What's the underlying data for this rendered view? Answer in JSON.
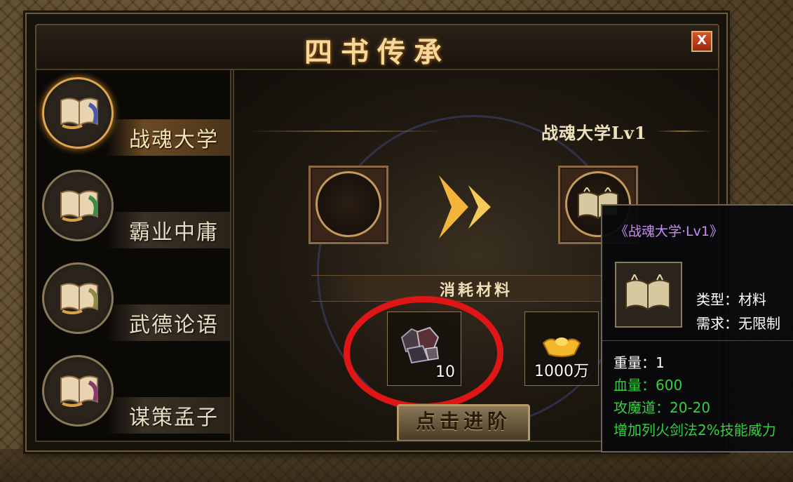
{
  "window": {
    "title": "四书传承",
    "close_label": "X"
  },
  "sidebar": {
    "items": [
      {
        "label": "战魂大学",
        "active": true,
        "accent": "#4a5aa8"
      },
      {
        "label": "霸业中庸",
        "active": false,
        "accent": "#3a8a4a"
      },
      {
        "label": "武德论语",
        "active": false,
        "accent": "#8a8a44"
      },
      {
        "label": "谋策孟子",
        "active": false,
        "accent": "#8a3a6a"
      }
    ]
  },
  "main": {
    "level_title": "战魂大学Lv1",
    "materials_label": "消耗材料",
    "materials": [
      {
        "icon": "ore-icon",
        "qty": "10"
      },
      {
        "icon": "gold-ingot-icon",
        "qty": "1000万"
      }
    ],
    "advance_button": "点击进阶"
  },
  "tooltip": {
    "title": "《战魂大学·Lv1》",
    "type": "类型：材料",
    "requirement": "需求：无限制",
    "weight": "重量：1",
    "hp": "血量：600",
    "attack": "攻魔道：20-20",
    "bonus": "增加列火剑法2%技能威力"
  },
  "colors": {
    "gold": "#f5d89a",
    "tooltip_title": "#c88ef0",
    "tooltip_stat": "#32d23c",
    "highlight_marker": "#e01616"
  }
}
